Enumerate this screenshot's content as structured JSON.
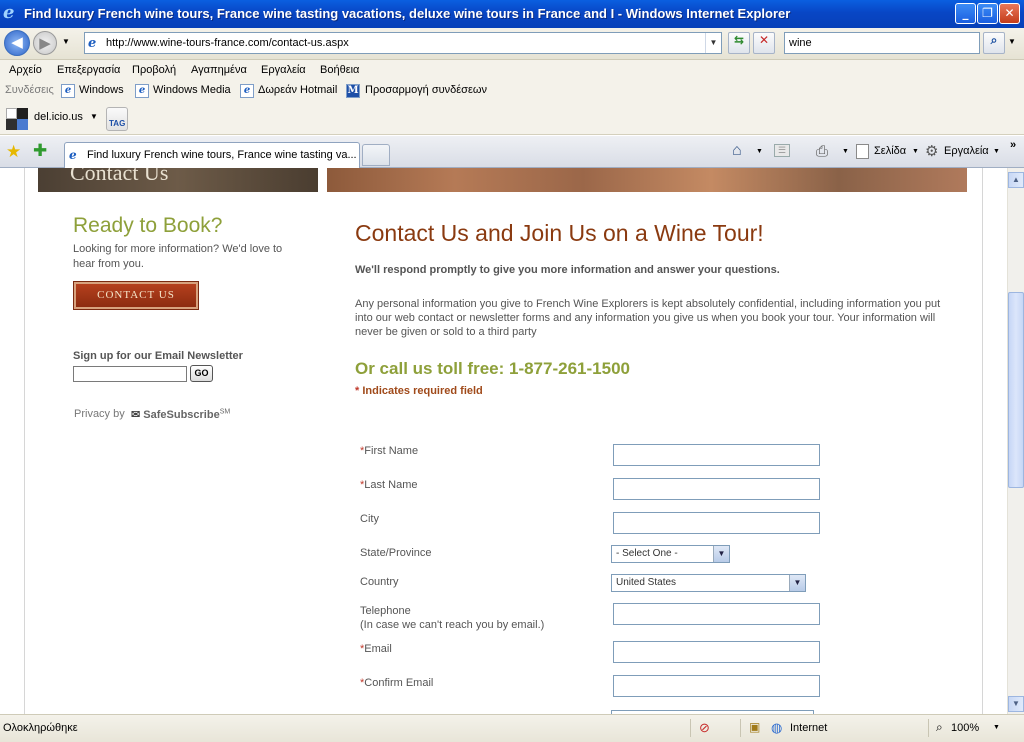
{
  "window": {
    "title": "Find luxury French wine tours, France wine tasting vacations, deluxe wine tours in France and I - Windows Internet Explorer",
    "controls": {
      "minimize": "_",
      "maximize": "❐",
      "close": "✕"
    }
  },
  "navbar": {
    "back_icon": "◀",
    "forward_icon": "▶",
    "url": "http://www.wine-tours-france.com/contact-us.aspx",
    "search_value": "wine"
  },
  "menu": {
    "items": [
      "Αρχείο",
      "Επεξεργασία",
      "Προβολή",
      "Αγαπημένα",
      "Εργαλεία",
      "Βοήθεια"
    ]
  },
  "links": {
    "label": "Συνδέσεις",
    "items": [
      "Windows",
      "Windows Media",
      "Δωρεάν Hotmail",
      "Προσαρμογή συνδέσεων"
    ]
  },
  "delicious": {
    "label": "del.icio.us",
    "tag": "TAG"
  },
  "tabs": {
    "active_title": "Find luxury French wine tours, France wine tasting va...",
    "tools": {
      "page": "Σελίδα",
      "tools": "Εργαλεία"
    }
  },
  "page": {
    "hero_text": "Contact Us",
    "sidebar": {
      "title": "Ready to Book?",
      "text": "Looking for more information? We'd love to hear from you.",
      "contact_button": "CONTACT US",
      "newsletter_label": "Sign up for our Email Newsletter",
      "go_button": "GO",
      "privacy_label": "Privacy by",
      "safesubscribe": "SafeSubscribe",
      "safesubscribe_mark": "SM"
    },
    "main": {
      "title": "Contact Us and Join Us on a Wine Tour!",
      "respond": "We'll respond promptly to give you more information and answer your questions.",
      "privacy": "Any personal information you give to French Wine Explorers is kept absolutely confidential, including information you put into our web contact or newsletter forms and any information you give us when you book your tour. Your information will never be given or sold to a third party",
      "tollfree": "Or call us toll free: 1-877-261-1500",
      "required_star": "*",
      "required_text": "Indicates required field"
    },
    "form": {
      "first_name": "First Name",
      "last_name": "Last Name",
      "city": "City",
      "state": "State/Province",
      "state_value": "- Select One -",
      "country": "Country",
      "country_value": "United States",
      "telephone": "Telephone",
      "telephone_note": "(In case we can't reach you by email.)",
      "email": "Email",
      "confirm_email": "Confirm Email"
    }
  },
  "status": {
    "text": "Ολοκληρώθηκε",
    "zone": "Internet",
    "zoom": "100%"
  }
}
